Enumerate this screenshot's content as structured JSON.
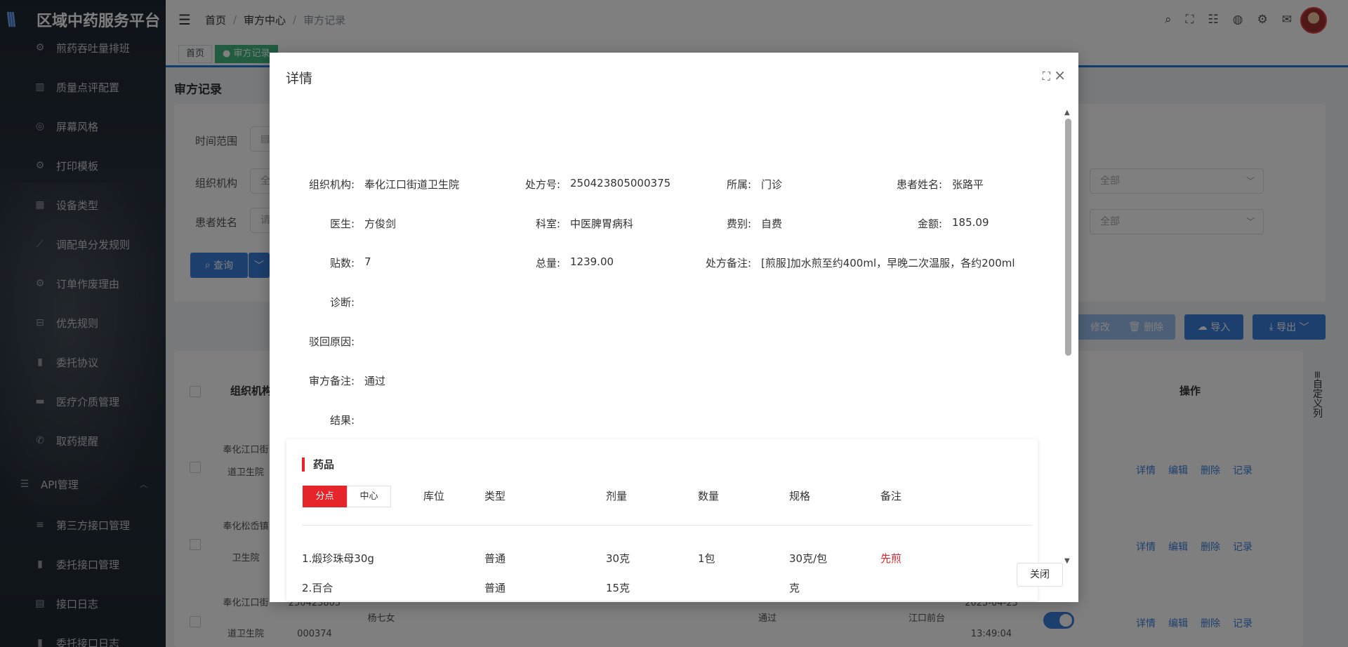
{
  "app": {
    "title": "区域中药服务平台"
  },
  "sidebar": {
    "items": [
      {
        "label": "煎药吞吐量排班",
        "icon": "gear-icon"
      },
      {
        "label": "质量点评配置",
        "icon": "trash-icon"
      },
      {
        "label": "屏幕风格",
        "icon": "palette-icon"
      },
      {
        "label": "打印模板",
        "icon": "gear-icon"
      },
      {
        "label": "设备类型",
        "icon": "grid-icon"
      },
      {
        "label": "调配单分发规则",
        "icon": "chart-line-icon"
      },
      {
        "label": "订单作废理由",
        "icon": "gear-icon"
      },
      {
        "label": "优先规则",
        "icon": "box-icon"
      },
      {
        "label": "委托协议",
        "icon": "bar-chart-icon"
      },
      {
        "label": "医疗介质管理",
        "icon": "stamp-icon"
      },
      {
        "label": "取药提醒",
        "icon": "phone-icon"
      }
    ],
    "group": {
      "label": "API管理",
      "icon": "sliders-icon"
    },
    "sub_items": [
      {
        "label": "第三方接口管理",
        "icon": "list-icon"
      },
      {
        "label": "委托接口管理",
        "icon": "bar-chart-icon"
      },
      {
        "label": "接口日志",
        "icon": "log-icon"
      },
      {
        "label": "委托接口日志",
        "icon": "bar-chart-icon"
      }
    ]
  },
  "header": {
    "breadcrumb": [
      "首页",
      "审方中心",
      "审方记录"
    ]
  },
  "tabs": [
    "首页",
    "审方记录"
  ],
  "page": {
    "title": "审方记录",
    "filters": {
      "time_range_label": "时间范围",
      "org_label": "组织机构",
      "org_placeholder": "全",
      "patient_label": "患者姓名",
      "patient_placeholder": "请",
      "select1_value": "全部",
      "select2_value": "全部"
    },
    "query_button": "查询",
    "actions": {
      "edit": "修改",
      "delete": "删除",
      "import": "导入",
      "export": "导出"
    },
    "table": {
      "col_org": "组织机构",
      "col_op": "操作",
      "custom_column": "自定义列",
      "rows": [
        {
          "org_1": "奉化江口街",
          "org_2": "道卫生院"
        },
        {
          "org_1": "奉化松岙镇",
          "org_2": "卫生院"
        },
        {
          "org_1": "奉化江口街",
          "org_2": "道卫生院",
          "rx_1": "250423805",
          "rx_2": "000374",
          "patient": "杨七女",
          "status": "通过",
          "location": "江口前台",
          "date": "2025-04-23",
          "time": "13:49:04"
        }
      ],
      "ops": {
        "detail": "详情",
        "edit": "编辑",
        "delete": "删除",
        "log": "记录"
      }
    }
  },
  "modal": {
    "title": "详情",
    "fields": {
      "org_label": "组织机构:",
      "org": "奉化江口街道卫生院",
      "rx_label": "处方号:",
      "rx": "250423805000375",
      "belong_label": "所属:",
      "belong": "门诊",
      "patient_label": "患者姓名:",
      "patient": "张路平",
      "doctor_label": "医生:",
      "doctor": "方俊剑",
      "dept_label": "科室:",
      "dept": "中医脾胃病科",
      "fee_label": "费别:",
      "fee": "自费",
      "amount_label": "金额:",
      "amount": "185.09",
      "doses_label": "贴数:",
      "doses": "7",
      "total_label": "总量:",
      "total": "1239.00",
      "rx_note_label": "处方备注:",
      "rx_note": "[煎服]加水煎至约400ml，早晚二次温服，各约200ml",
      "diagnosis_label": "诊断:",
      "diagnosis": "",
      "reject_label": "驳回原因:",
      "reject": "",
      "review_note_label": "审方备注:",
      "review_note": "通过",
      "result_label": "结果:",
      "result": ""
    },
    "drugs": {
      "title": "药品",
      "segments": [
        "分点",
        "中心"
      ],
      "columns": [
        "库位",
        "类型",
        "剂量",
        "数量",
        "规格",
        "备注"
      ],
      "rows": [
        {
          "name": "1.煅珍珠母30g",
          "type": "普通",
          "dose": "30克",
          "qty": "1包",
          "spec": "30克/包",
          "note": "先煎"
        },
        {
          "name": "2.百合",
          "type": "普通",
          "dose": "15克",
          "qty": "",
          "spec": "克",
          "note": ""
        }
      ]
    },
    "close_button": "关闭"
  }
}
